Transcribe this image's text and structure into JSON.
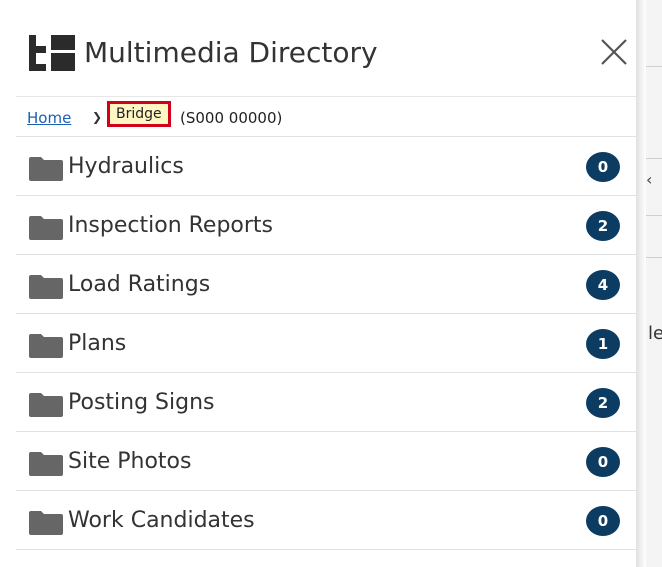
{
  "header": {
    "title": "Multimedia Directory",
    "logo_icon": "directory-logo-icon",
    "close_icon": "close-icon"
  },
  "breadcrumb": {
    "home": "Home",
    "separator": "❯",
    "current": "Bridge",
    "current_id": "(S000 00000)"
  },
  "folders": [
    {
      "name": "Hydraulics",
      "count": "0"
    },
    {
      "name": "Inspection Reports",
      "count": "2"
    },
    {
      "name": "Load Ratings",
      "count": "4"
    },
    {
      "name": "Plans",
      "count": "1"
    },
    {
      "name": "Posting Signs",
      "count": "2"
    },
    {
      "name": "Site Photos",
      "count": "0"
    },
    {
      "name": "Work Candidates",
      "count": "0"
    }
  ],
  "background": {
    "fragment_text": "le",
    "chevron": "‹"
  },
  "colors": {
    "badge": "#0c3c61",
    "link": "#1a5fb4",
    "highlight_fill": "#fff6c4",
    "highlight_border": "#d0021b",
    "folder": "#666666"
  }
}
